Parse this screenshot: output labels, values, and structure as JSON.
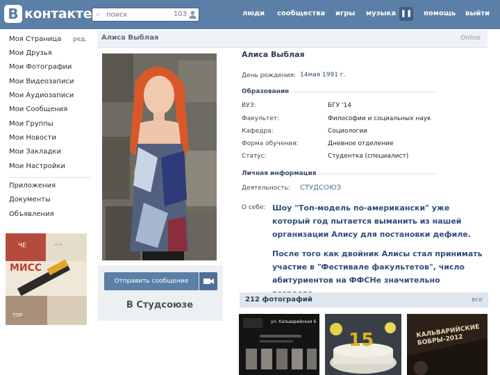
{
  "header": {
    "logo_letter": "В",
    "logo_text": "контакте",
    "search_placeholder": "поиск",
    "search_count": "103",
    "nav": [
      "люди",
      "сообщества",
      "игры",
      "музыка",
      "помощь",
      "выйти"
    ],
    "brand_color": "#5b7fa6"
  },
  "sidebar": {
    "edit_label": "ред.",
    "items": [
      "Моя Страница",
      "Мои Друзья",
      "Мои Фотографии",
      "Мои Видеозаписи",
      "Мои Аудиозаписи",
      "Мои Сообщения",
      "Мои Группы",
      "Мои Новости",
      "Мои Закладки",
      "Мои Настройки"
    ],
    "apps": [
      "Приложения",
      "Документы",
      "Объявления"
    ],
    "promo_text": "МИСС"
  },
  "profile": {
    "bar_name": "Алиса Выблая",
    "status": "Online",
    "name": "Алиса Выблая",
    "birthday_label": "День рождения:",
    "birthday_value": "14мая 1991 г.",
    "education_title": "Образование",
    "edu": [
      {
        "label": "ВУЗ:",
        "value": "БГУ '14"
      },
      {
        "label": "Факультет:",
        "value": "Философии и социальных наук"
      },
      {
        "label": "Кафедра:",
        "value": "Социологии"
      },
      {
        "label": "Форма обучения:",
        "value": "Дневное отделение"
      },
      {
        "label": "Статус:",
        "value": "Студентка (специалист)"
      }
    ],
    "personal_title": "Личная информация",
    "activity_label": "Деятельность:",
    "activity_value": "СТУДСОЮЗ",
    "about_label": "О себе:",
    "about_p1": "Шоу \"Топ-модель по-американски\" уже который год пытается выманить из нашей организации Алису для постановки дефиле.",
    "about_p2": "После того как двойник Алисы стал принимать участие в \"Фестивале факультетов\", число абитуриентов на ФФСНе значительно возросло.",
    "send_message": "Отправить сообщение",
    "in_studsoyuz": "В Студсоюзе"
  },
  "photos": {
    "title": "212 фотографий",
    "all": "все",
    "thumb1_text": "ул. Кальварийская 6",
    "thumb3_text": "КАЛЬВАРИЙСКИЕ БОБРЫ-2012"
  }
}
